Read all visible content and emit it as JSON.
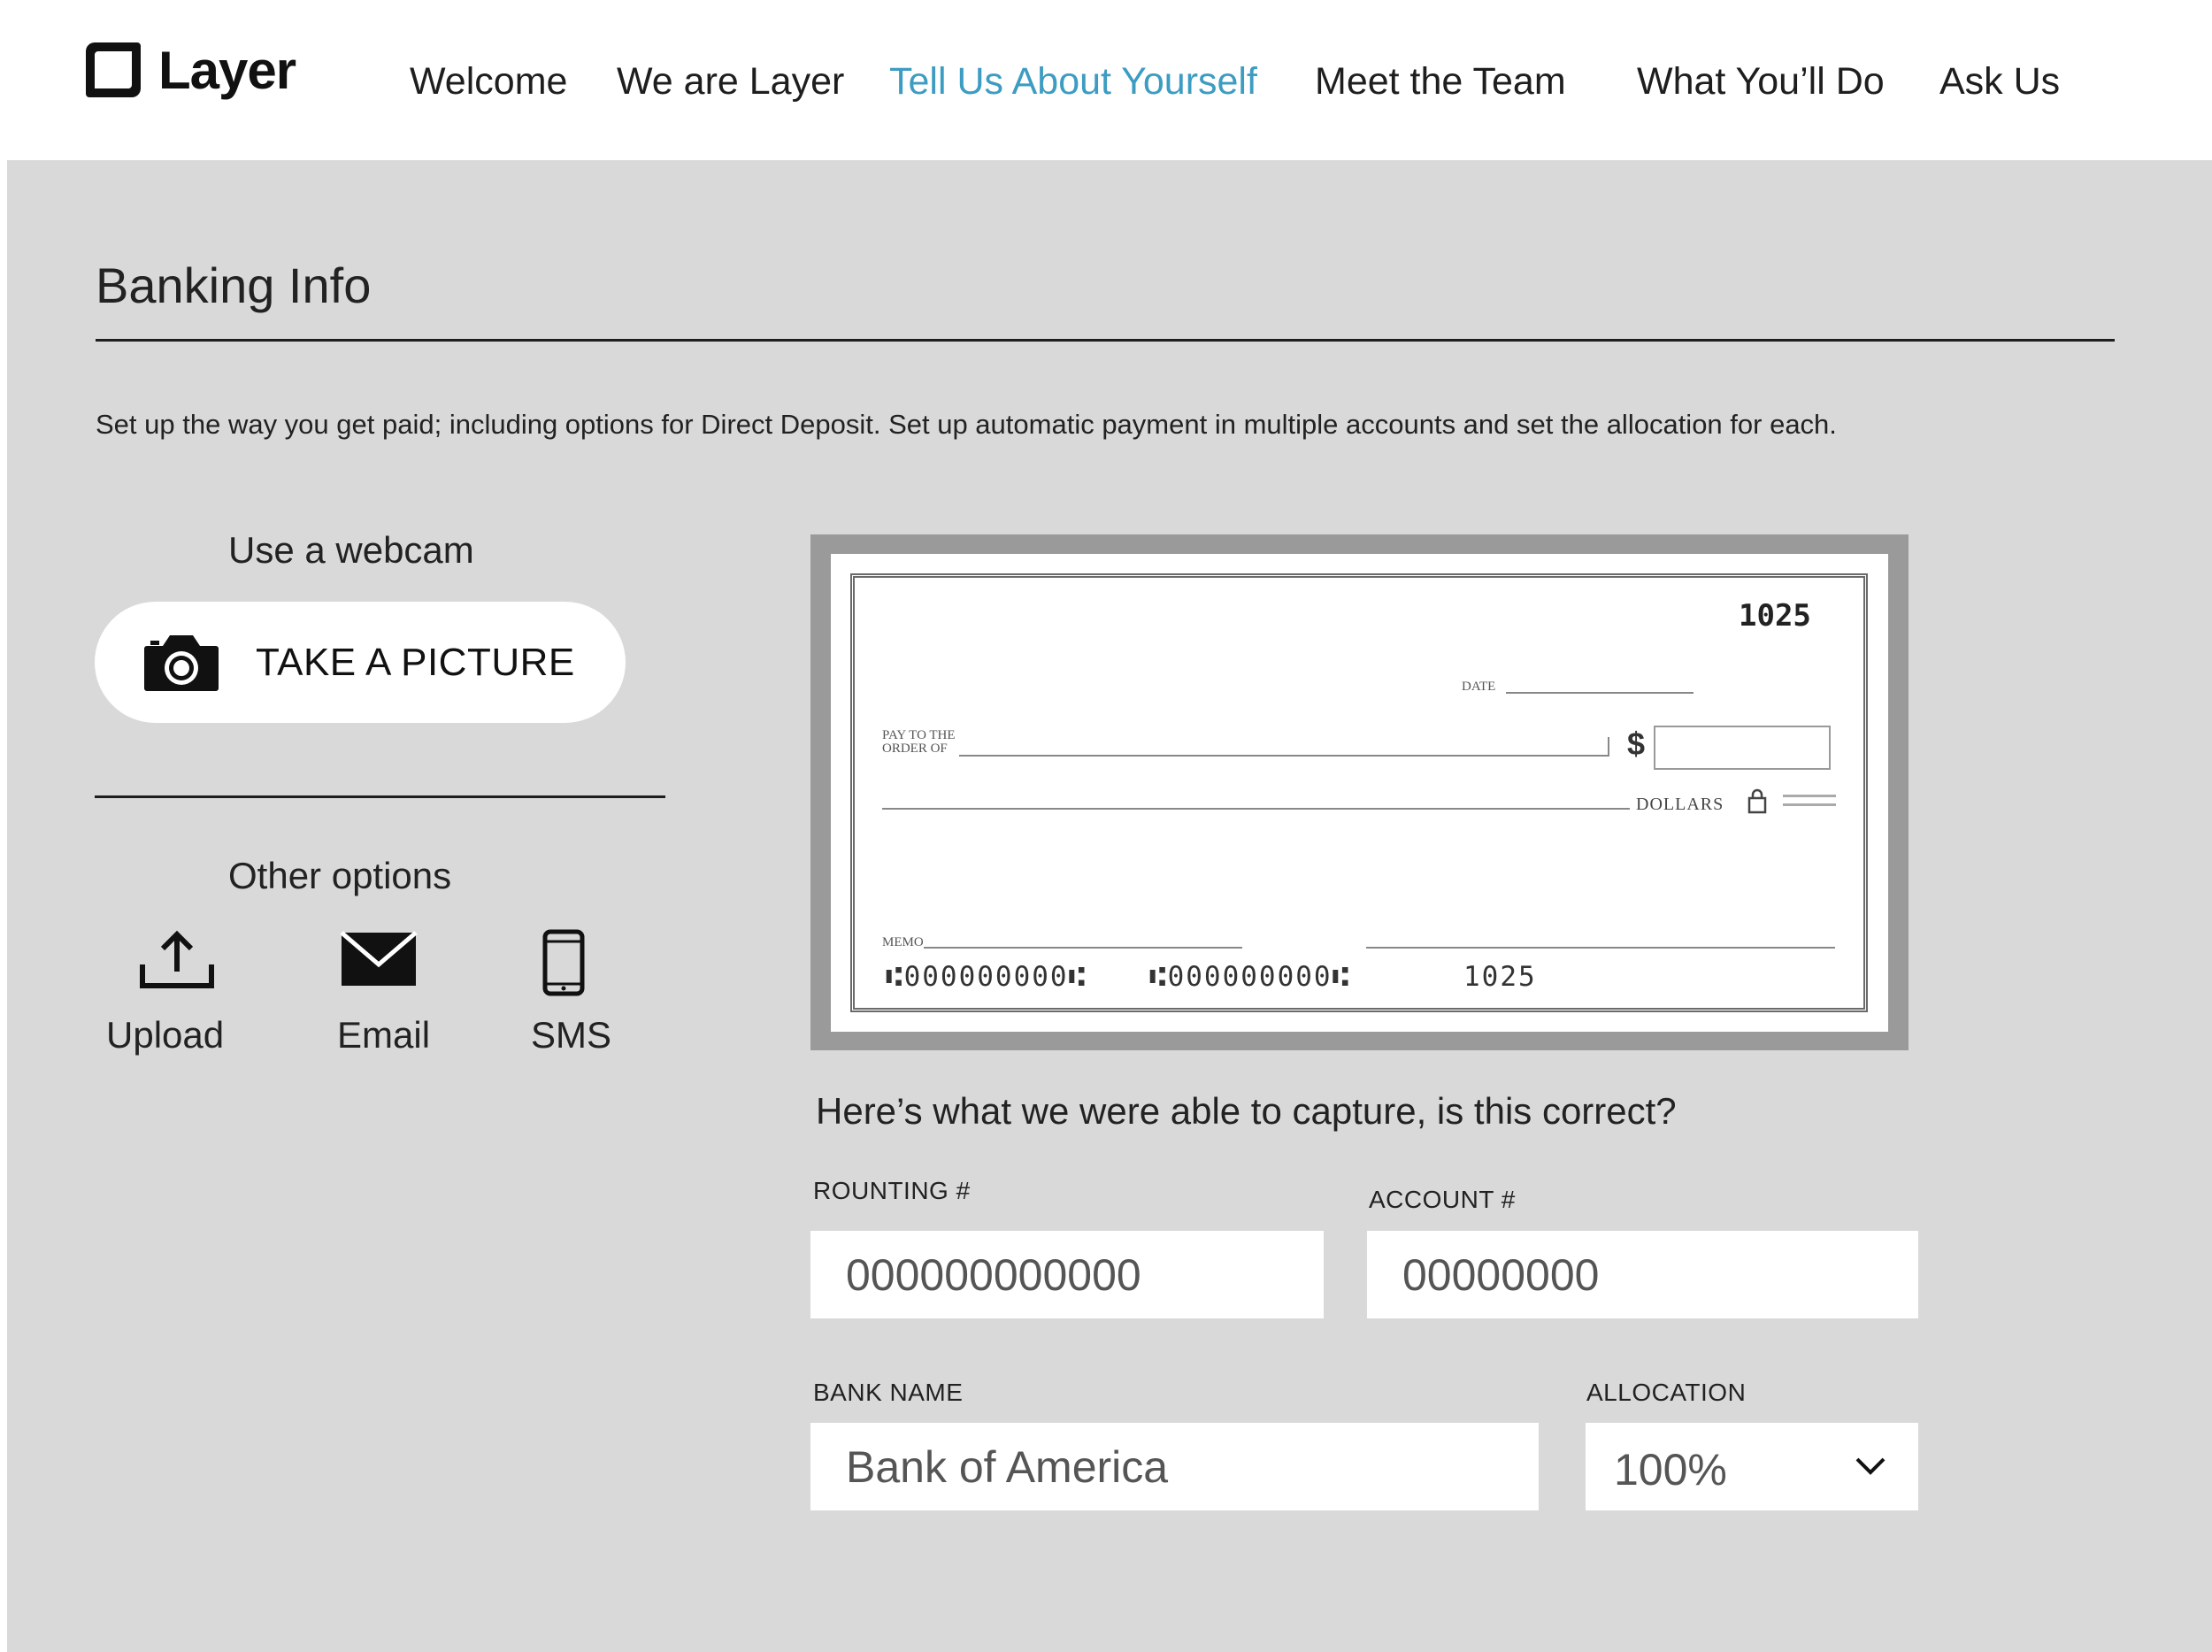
{
  "app": {
    "logo_text": "Layer"
  },
  "nav": {
    "items": [
      {
        "label": "Welcome",
        "active": false
      },
      {
        "label": "We are Layer",
        "active": false
      },
      {
        "label": "Tell Us About Yourself",
        "active": true
      },
      {
        "label": "Meet the Team",
        "active": false
      },
      {
        "label": "What You’ll Do",
        "active": false
      },
      {
        "label": "Ask Us",
        "active": false
      }
    ],
    "active_color": "#3d9cc2"
  },
  "section": {
    "title": "Banking Info",
    "description": "Set up the way you get paid; including options for Direct Deposit. Set up automatic payment in multiple accounts and set the allocation for each."
  },
  "webcam": {
    "label": "Use a webcam",
    "button_label": "TAKE A PICTURE",
    "icon": "camera-icon"
  },
  "other_options": {
    "label": "Other options",
    "items": [
      {
        "label": "Upload",
        "icon": "upload-icon"
      },
      {
        "label": "Email",
        "icon": "envelope-icon"
      },
      {
        "label": "SMS",
        "icon": "phone-icon"
      }
    ]
  },
  "check": {
    "number": "1025",
    "date_label": "DATE",
    "pay_to_label_1": "PAY TO THE",
    "pay_to_label_2": "ORDER OF",
    "dollar_sign": "$",
    "dollars_label": "DOLLARS",
    "memo_label": "MEMO",
    "micr_routing": "⑆000000000⑆",
    "micr_account": "⑆000000000⑆",
    "micr_check": "1025"
  },
  "form": {
    "question": "Here’s what we were able to capture, is this correct?",
    "routing_label": "ROUNTING #",
    "routing_value": "000000000000",
    "account_label": "ACCOUNT #",
    "account_value": "00000000",
    "bank_label": "BANK NAME",
    "bank_value": "Bank of America",
    "allocation_label": "ALLOCATION",
    "allocation_value": "100%"
  }
}
